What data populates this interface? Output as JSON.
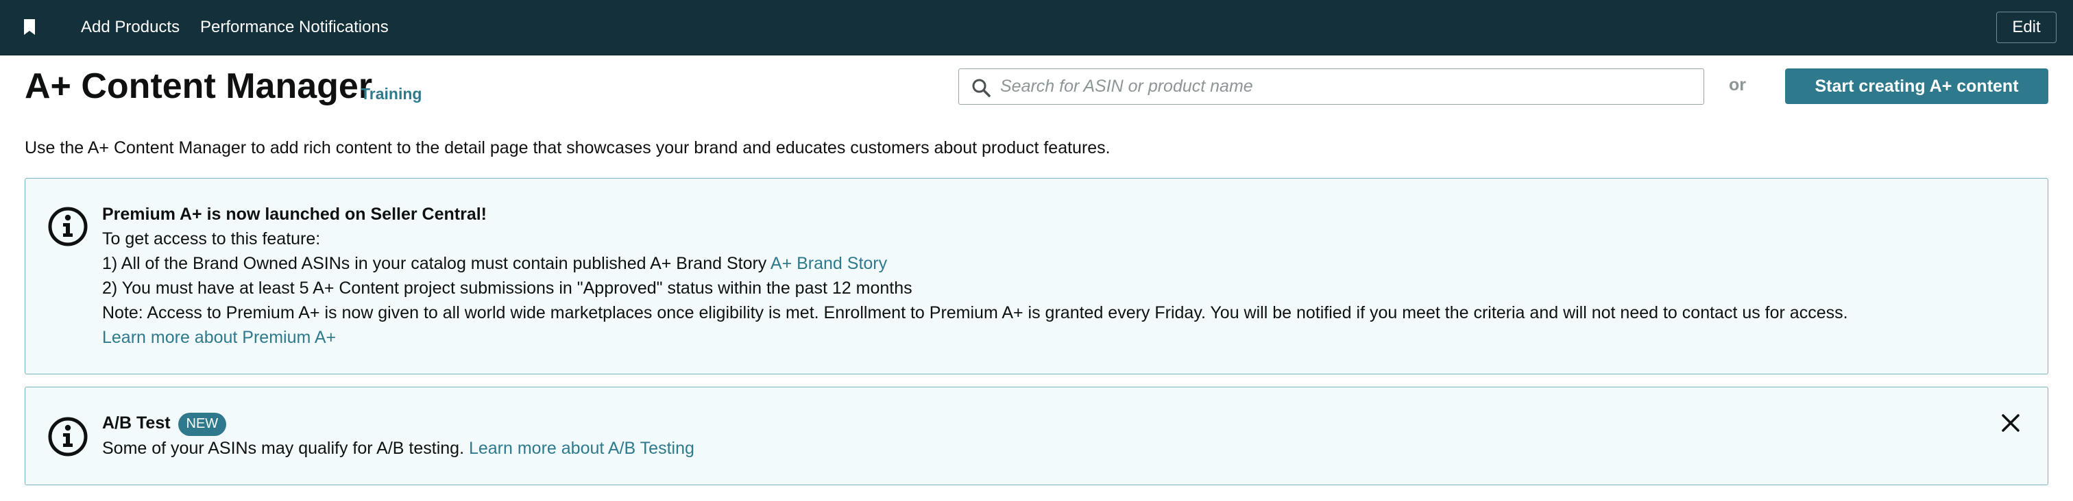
{
  "topbar": {
    "bookmark_icon": "bookmark-icon",
    "nav": [
      "Add Products",
      "Performance Notifications"
    ],
    "edit_label": "Edit",
    "background": "#13303b"
  },
  "header": {
    "title": "A+ Content Manager",
    "training_link": "Training",
    "search_placeholder": "Search for ASIN or product name",
    "search_icon": "search-icon",
    "or_text": "or",
    "primary_button": "Start creating A+ content"
  },
  "description": "Use the A+ Content Manager to add rich content to the detail page that showcases your brand and educates customers about product features.",
  "alerts": {
    "premium": {
      "icon": "info-icon",
      "heading": "Premium A+ is now launched on Seller Central!",
      "line1": "To get access to this feature:",
      "line2_text": "1) All of the Brand Owned ASINs in your catalog must contain published A+ Brand Story",
      "line2_link": "A+ Brand Story",
      "line3": "2) You must have at least 5 A+ Content project submissions in \"Approved\" status within the past 12 months",
      "line4": "Note: Access to Premium A+ is now given to all world wide marketplaces once eligibility is met. Enrollment to Premium A+ is granted every Friday. You will be notified if you meet the criteria and will not need to contact us for access.",
      "learn_more": "Learn more about Premium A+"
    },
    "ab_test": {
      "icon": "info-icon",
      "heading": "A/B Test",
      "badge": "NEW",
      "text": "Some of your ASINs may qualify for A/B testing.",
      "link": "Learn more about A/B Testing",
      "close_icon": "close-icon"
    }
  },
  "colors": {
    "accent": "#2e7a8c",
    "alert_background": "#f2fafc",
    "alert_border": "#7fb4c4"
  }
}
